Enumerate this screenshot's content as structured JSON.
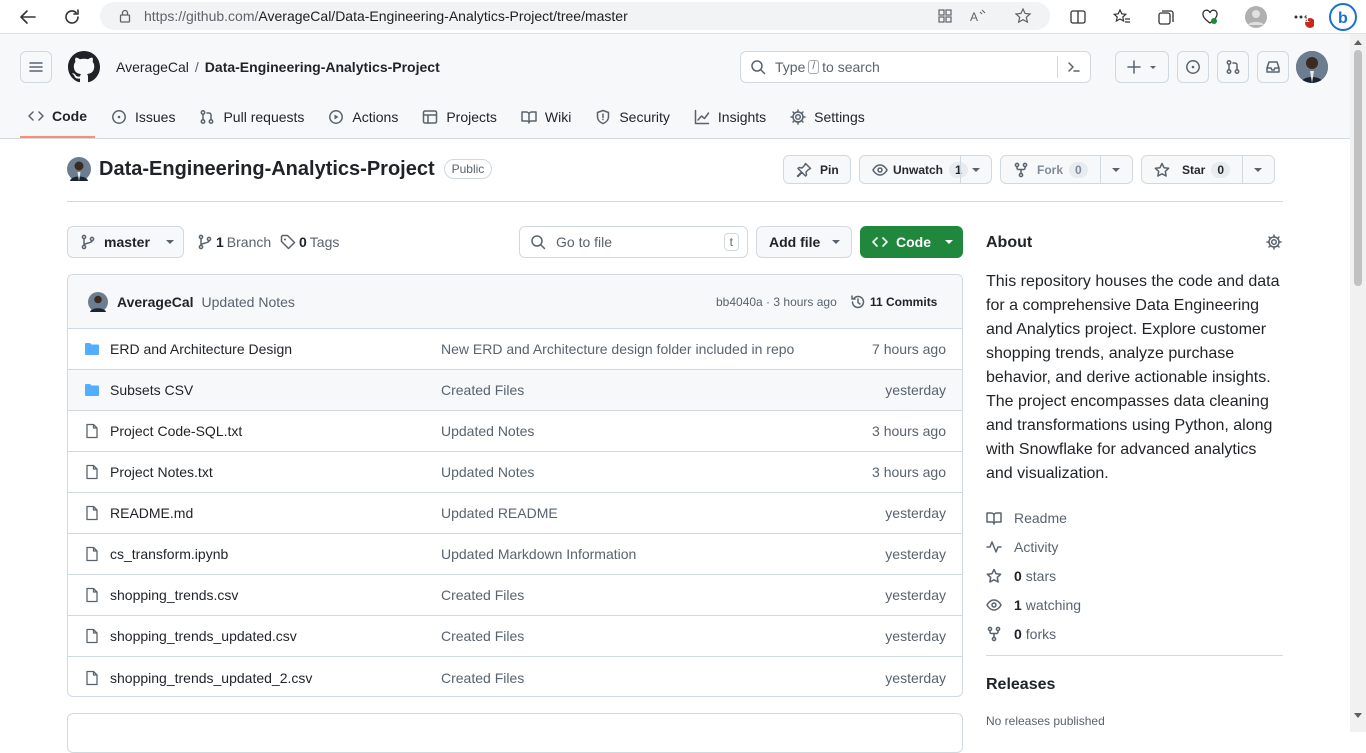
{
  "browser": {
    "url_prefix": "https://github.com/",
    "url_path": "AverageCal/Data-Engineering-Analytics-Project/tree/master",
    "notification_count": "1"
  },
  "header": {
    "owner": "AverageCal",
    "separator": "/",
    "repo": "Data-Engineering-Analytics-Project",
    "search_prefix": "Type",
    "search_key": "/",
    "search_suffix": "to search"
  },
  "nav": [
    {
      "label": "Code",
      "icon": "code-icon"
    },
    {
      "label": "Issues",
      "icon": "issue-icon"
    },
    {
      "label": "Pull requests",
      "icon": "pull-request-icon"
    },
    {
      "label": "Actions",
      "icon": "play-icon"
    },
    {
      "label": "Projects",
      "icon": "table-icon"
    },
    {
      "label": "Wiki",
      "icon": "book-icon"
    },
    {
      "label": "Security",
      "icon": "shield-icon"
    },
    {
      "label": "Insights",
      "icon": "graph-icon"
    },
    {
      "label": "Settings",
      "icon": "gear-icon"
    }
  ],
  "repo": {
    "name": "Data-Engineering-Analytics-Project",
    "visibility": "Public",
    "pin_label": "Pin",
    "unwatch_label": "Unwatch",
    "watch_count": "1",
    "fork_label": "Fork",
    "fork_count": "0",
    "star_label": "Star",
    "star_count": "0"
  },
  "toolbar": {
    "branch": "master",
    "branch_count": "1",
    "branch_label": "Branch",
    "tag_count": "0",
    "tag_label": "Tags",
    "goto_placeholder": "Go to file",
    "goto_key": "t",
    "add_file": "Add file",
    "code": "Code"
  },
  "commit": {
    "author": "AverageCal",
    "message": "Updated Notes",
    "hash_time": "bb4040a · 3 hours ago",
    "commits": "11 Commits"
  },
  "files": [
    {
      "name": "ERD and Architecture Design",
      "type": "folder",
      "message": "New ERD and Architecture design folder included in repo",
      "time": "7 hours ago"
    },
    {
      "name": "Subsets CSV",
      "type": "folder",
      "message": "Created Files",
      "time": "yesterday"
    },
    {
      "name": "Project Code-SQL.txt",
      "type": "file",
      "message": "Updated Notes",
      "time": "3 hours ago"
    },
    {
      "name": "Project Notes.txt",
      "type": "file",
      "message": "Updated Notes",
      "time": "3 hours ago"
    },
    {
      "name": "README.md",
      "type": "file",
      "message": "Updated README",
      "time": "yesterday"
    },
    {
      "name": "cs_transform.ipynb",
      "type": "file",
      "message": "Updated Markdown Information",
      "time": "yesterday"
    },
    {
      "name": "shopping_trends.csv",
      "type": "file",
      "message": "Created Files",
      "time": "yesterday"
    },
    {
      "name": "shopping_trends_updated.csv",
      "type": "file",
      "message": "Created Files",
      "time": "yesterday"
    },
    {
      "name": "shopping_trends_updated_2.csv",
      "type": "file",
      "message": "Created Files",
      "time": "yesterday"
    }
  ],
  "about": {
    "title": "About",
    "description": "This repository houses the code and data for a comprehensive Data Engineering and Analytics project. Explore customer shopping trends, analyze purchase behavior, and derive actionable insights. The project encompasses data cleaning and transformations using Python, along with Snowflake for advanced analytics and visualization.",
    "readme": "Readme",
    "activity": "Activity",
    "stars_count": "0",
    "stars_label": "stars",
    "watching_count": "1",
    "watching_label": "watching",
    "forks_count": "0",
    "forks_label": "forks"
  },
  "releases": {
    "title": "Releases",
    "text": "No releases published"
  },
  "colors": {
    "accent_green": "#1f883d",
    "nav_underline": "#fd8c73",
    "folder_blue": "#54aeff"
  }
}
